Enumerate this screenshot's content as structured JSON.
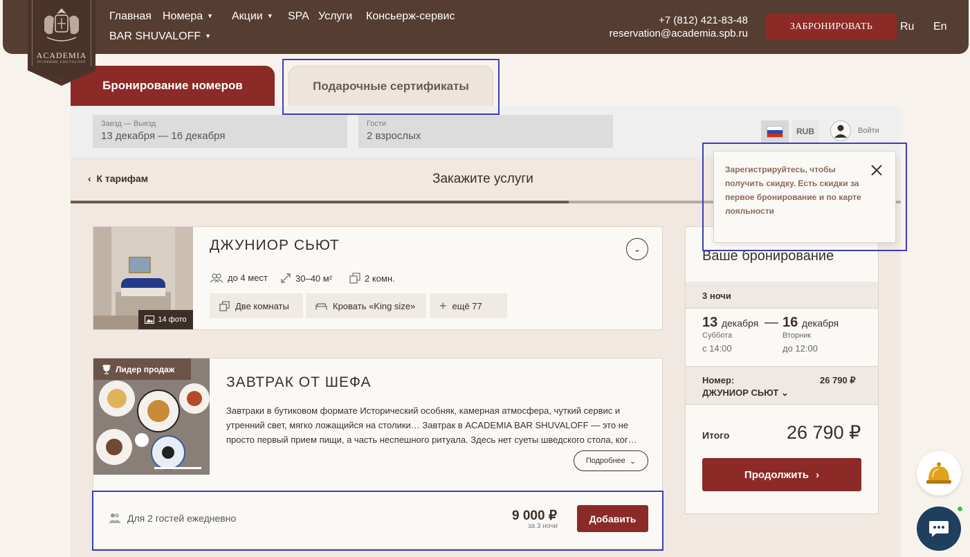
{
  "header": {
    "logo_name": "ACADEMIA",
    "logo_sub": "ОСОБНЯК SHUVALOFF",
    "nav": [
      {
        "label": "Главная",
        "dropdown": false
      },
      {
        "label": "Номера",
        "dropdown": true
      },
      {
        "label": "Акции",
        "dropdown": true
      },
      {
        "label": "SPA",
        "dropdown": false
      },
      {
        "label": "Услуги",
        "dropdown": false
      },
      {
        "label": "Консьерж-сервис",
        "dropdown": false
      },
      {
        "label": "BAR SHUVALOFF",
        "dropdown": true
      }
    ],
    "phone": "+7 (812) 421-83-48",
    "email": "reservation@academia.spb.ru",
    "book_button": "ЗАБРОНИРОВАТЬ",
    "lang_ru": "Ru",
    "lang_en": "En"
  },
  "tabs": {
    "rooms": "Бронирование номеров",
    "certificates": "Подарочные сертификаты"
  },
  "search": {
    "dates_label": "Заезд — Выезд",
    "dates_value": "13 декабря — 16 декабря",
    "guests_label": "Гости",
    "guests_value": "2 взрослых",
    "currency": "RUB",
    "login": "Войти"
  },
  "steps": {
    "back": "К тарифам",
    "title": "Закажите услуги",
    "progress": 0.6
  },
  "popover": {
    "text": "Зарегистрируйтесь, чтобы получить скидку. Есть скидки за первое бронирование и по карте лояльности"
  },
  "room": {
    "title": "ДЖУНИОР СЬЮТ",
    "photos": "14 фото",
    "guests": "до 4 мест",
    "area": "30–40 м²",
    "rooms": "2 комн.",
    "chips": [
      "Две комнаты",
      "Кровать «King size»",
      "ещё 77"
    ]
  },
  "service": {
    "badge": "Лидер продаж",
    "title": "ЗАВТРАК ОТ ШЕФА",
    "description": "Завтраки в бутиковом формате Исторический особняк, камерная атмосфера, чуткий сервис и утренний свет, мягко ложащийся на столики… Завтрак в ACADEMIA BAR SHUVALOFF — это не просто первый прием пищи, а часть неспешного ритуала. Здесь нет суеты шведского стола, ког…",
    "more": "Подробнее",
    "guests": "Для 2 гостей ежедневно",
    "price": "9 000 ₽",
    "per": "за 3 ночи",
    "add": "Добавить"
  },
  "summary": {
    "title": "Ваше бронирование",
    "nights": "3 ночи",
    "checkin_day": "13",
    "checkin_month": "декабря",
    "dash": "—",
    "checkout_day": "16",
    "checkout_month": "декабря",
    "checkin_weekday": "Суббота",
    "checkout_weekday": "Вторник",
    "checkin_time": "с 14:00",
    "checkout_time": "до 12:00",
    "room_label": "Номер:",
    "room_price": "26 790 ₽",
    "room_name": "ДЖУНИОР СЬЮТ",
    "total_label": "Итого",
    "total": "26 790 ₽",
    "continue": "Продолжить"
  },
  "colors": {
    "brand_brown": "#563d31",
    "accent_red": "#8b2a26",
    "highlight": "#3d3db8"
  }
}
